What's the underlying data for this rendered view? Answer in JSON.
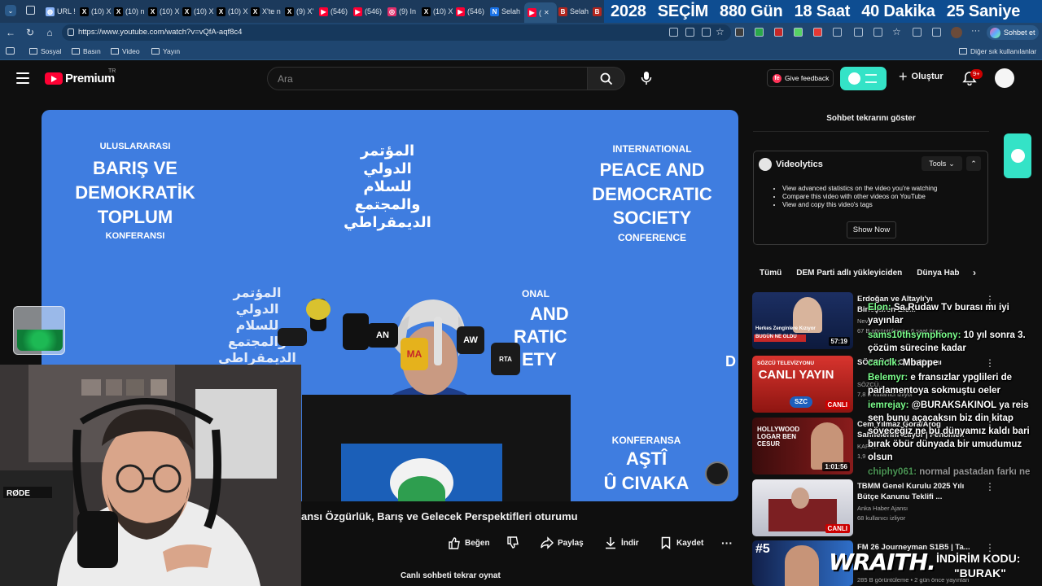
{
  "browser": {
    "tabs": [
      {
        "label": "URL !",
        "icon": "globe-icon",
        "color": "#8ab4f8"
      },
      {
        "label": "(10) X",
        "icon": "x-logo-icon",
        "color": "#ffffff"
      },
      {
        "label": "(10) n",
        "icon": "x-logo-icon",
        "color": "#ffffff"
      },
      {
        "label": "(10) X",
        "icon": "x-logo-icon",
        "color": "#ffffff"
      },
      {
        "label": "(10) X",
        "icon": "x-logo-icon",
        "color": "#ffffff"
      },
      {
        "label": "(10) X",
        "icon": "x-logo-icon",
        "color": "#ffffff"
      },
      {
        "label": "X'te n",
        "icon": "x-logo-icon",
        "color": "#ffffff"
      },
      {
        "label": "(9) X'",
        "icon": "x-logo-icon",
        "color": "#ffffff"
      },
      {
        "label": "(546)",
        "icon": "youtube-icon",
        "color": "#ff0033"
      },
      {
        "label": "(546)",
        "icon": "youtube-icon",
        "color": "#ff0033"
      },
      {
        "label": "(9) In",
        "icon": "instagram-icon",
        "color": "#e1306c"
      },
      {
        "label": "(10) X",
        "icon": "x-logo-icon",
        "color": "#ffffff"
      },
      {
        "label": "(546)",
        "icon": "youtube-icon",
        "color": "#ff0033"
      },
      {
        "label": "Selah",
        "icon": "news-icon",
        "color": "#1a73e8"
      },
      {
        "label": "(",
        "icon": "youtube-icon",
        "color": "#ff0033"
      },
      {
        "label": "Selah",
        "icon": "b-icon",
        "color": "#b3261e"
      },
      {
        "label": "",
        "icon": "b-icon",
        "color": "#b3261e"
      }
    ],
    "election_banner": [
      "2028",
      "SEÇİM",
      "880 Gün",
      "18 Saat",
      "40 Dakika",
      "25 Saniye"
    ],
    "url": "https://www.youtube.com/watch?v=vQfA-aqf8c4",
    "chat_button": "Sohbet et",
    "bookmarks": [
      "Sosyal",
      "Basın",
      "Video",
      "Yayın"
    ],
    "other_bookmarks": "Diğer sık kullanılanlar"
  },
  "youtube": {
    "logo_text": "Premium",
    "logo_region": "TR",
    "search_placeholder": "Ara",
    "feedback_label": "Give feedback",
    "create_label": "Oluştur",
    "notif_count": "9+"
  },
  "player": {
    "banner_left": {
      "line1": "ULUSLARARASI",
      "line2": "BARIŞ VE",
      "line3": "DEMOKRATİK",
      "line4": "TOPLUM",
      "line5": "KONFERANSI"
    },
    "banner_right": {
      "line1": "INTERNATIONAL",
      "line2": "PEACE AND",
      "line3": "DEMOCRATIC",
      "line4": "SOCIETY",
      "line5": "CONFERENCE"
    },
    "banner_arabic": "المؤتمر الدولي للسلام والمجتمع الديمقراطي",
    "banner_right_fragment": {
      "line1": "ONAL",
      "line2": "AND",
      "line3": "RATIC",
      "line4": "ETY"
    },
    "podium_text": {
      "line1": "KONFERANSA",
      "line2": "AŞTÎ",
      "line3": "Û CIVAKA"
    },
    "mic_labels": [
      "AN",
      "MA",
      "AW",
      "RTA"
    ]
  },
  "video": {
    "title": "ansı Özgürlük, Barış ve Gelecek Perspektifleri oturumu",
    "actions": {
      "like": "Beğen",
      "share": "Paylaş",
      "download": "İndir",
      "save": "Kaydet"
    },
    "replay_label": "Canlı sohbeti tekrar oynat"
  },
  "sidebar": {
    "chat_replay_label": "Sohbet tekrarını göster",
    "videolytics": {
      "title": "Videolytics",
      "tools_label": "Tools",
      "features": [
        "View advanced statistics on the video you're watching",
        "Compare this video with other videos on YouTube",
        "View and copy this video's tags"
      ],
      "show_now_label": "Show Now"
    },
    "chips": [
      "Tümü",
      "DEM Parti adlı yükleyiciden",
      "Dünya Hab"
    ],
    "recommendations": [
      {
        "title": "Erdoğan ve Altaylı'yı Birleştiren Ele...",
        "channel": "Nev...",
        "meta": "67 B görüntüleme • 6 saat önce",
        "duration": "57:19",
        "thumb_caption": "Herkes Zenginlere Kızıyor",
        "thumb_strip": "BUGÜN NE OLDU",
        "live": false
      },
      {
        "title": "SÖZCÜ TV Canlı Yayını",
        "channel": "SÖZCÜ...",
        "meta": "7,8 B kullanıcı izliyor",
        "thumb_caption": "SÖZCÜ TELEVİZYONU",
        "thumb_big": "CANLI YAYIN",
        "thumb_logo": "SZC",
        "live_label": "CANLI",
        "live": true
      },
      {
        "title": "Cem Yılmaz Gora/Arog Sahnelerini İzliyor | Fenomen ...",
        "channel": "KAFA...",
        "meta": "1,9 ...",
        "duration": "1:01:56",
        "thumb_caption": "HOLLYWOOD LOGAR BEN CESUR",
        "live": false
      },
      {
        "title": "TBMM Genel Kurulu 2025 Yılı Bütçe Kanunu Teklifi ...",
        "channel": "Anka Haber Ajansı",
        "meta": "68 kullanıcı izliyor",
        "live_label": "CANLI",
        "live": true
      },
      {
        "title": "FM 26 Journeyman S1B5 | Ta...",
        "channel": "",
        "meta": "285 B görüntüleme • 2 gün önce yayınlan",
        "thumb_caption": "#5",
        "live": false
      }
    ],
    "chat_overlay": [
      {
        "user": "Elon:",
        "text": "Sa Rudaw Tv burası mı iyi yayınlar"
      },
      {
        "user": "sams10thsymphony:",
        "text": "10 yıl sonra 3. çözüm sürecine kadar"
      },
      {
        "user": "canclk:",
        "text": "Mbappe"
      },
      {
        "user": "Belemyr:",
        "text": "e fransızlar ypglileri de parlamentoya sokmuştu oeler"
      },
      {
        "user": "iemrejay:",
        "text": "@BURAKSAKINOL ya reis sen bunu açacaksın biz din kitap söveceğiz ne bu dünyamız kaldı bari bırak öbür dünyada bir umudumuz olsun"
      },
      {
        "user": "chiphy061:",
        "text": "normal pastadan farkı ne"
      }
    ],
    "promo": {
      "brand": "WRAITH.",
      "code_label": "İNDİRİM KODU:",
      "code": "\"BURAK\""
    }
  },
  "colors": {
    "tab_strip": "#1c3a5c",
    "election_banner": "#0e4d91",
    "youtube_red": "#ff0033",
    "extension_teal": "#34e3c7",
    "stage_blue": "#3f7de0",
    "chat_user": "#7cff8d"
  }
}
